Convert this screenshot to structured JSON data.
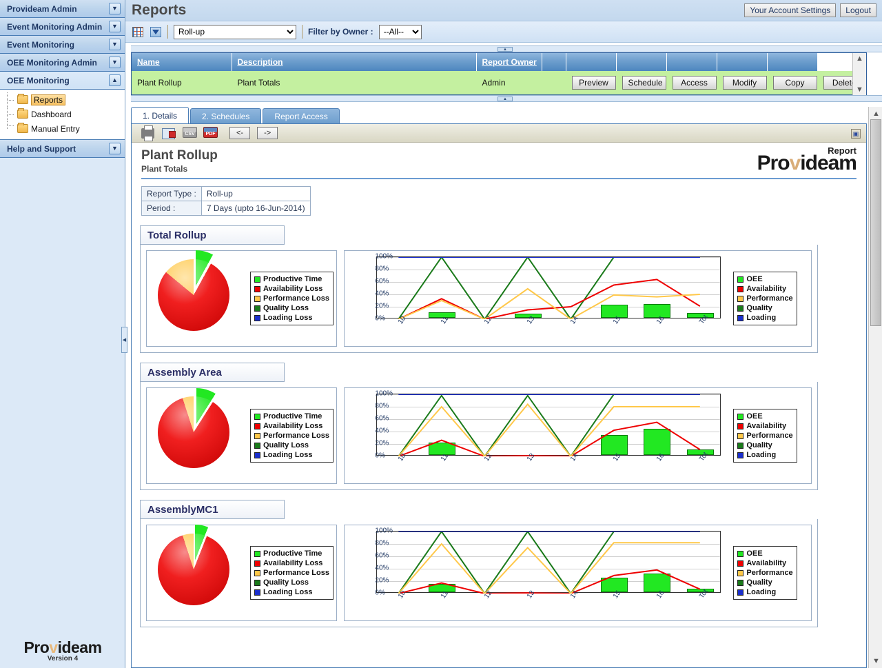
{
  "sidebar": {
    "groups": [
      {
        "label": "Provideam Admin",
        "icon": "chevron-down-icon",
        "expanded": false
      },
      {
        "label": "Event Monitoring Admin",
        "icon": "chevron-down-icon",
        "expanded": false
      },
      {
        "label": "Event Monitoring",
        "icon": "chevron-down-icon",
        "expanded": false
      },
      {
        "label": "OEE Monitoring Admin",
        "icon": "chevron-down-icon",
        "expanded": false
      },
      {
        "label": "OEE Monitoring",
        "icon": "chevron-up-icon",
        "expanded": true
      },
      {
        "label": "Help and Support",
        "icon": "chevron-down-icon",
        "expanded": false
      }
    ],
    "children": [
      {
        "label": "Reports",
        "selected": true
      },
      {
        "label": "Dashboard",
        "selected": false
      },
      {
        "label": "Manual Entry",
        "selected": false
      }
    ],
    "logo": {
      "pre": "Pro",
      "tick": "v",
      "post": "ideam",
      "version": "Version 4"
    }
  },
  "header": {
    "title": "Reports",
    "account_button": "Your Account Settings",
    "logout_button": "Logout"
  },
  "toolbar": {
    "grid_icon": "grid-icon",
    "filter_icon": "funnel-icon",
    "report_type_value": "Roll-up",
    "report_type_options": [
      "Roll-up"
    ],
    "filter_label": "Filter by Owner :",
    "filter_value": "--All--",
    "filter_options": [
      "--All--"
    ]
  },
  "report_list": {
    "columns": [
      "Name",
      "Description",
      "Report Owner",
      "",
      "",
      "",
      "",
      "",
      ""
    ],
    "row": {
      "name": "Plant Rollup",
      "description": "Plant Totals",
      "owner": "Admin",
      "actions": [
        "Preview",
        "Schedule",
        "Access",
        "Modify",
        "Copy",
        "Delete"
      ]
    }
  },
  "tabs": [
    {
      "label": "1. Details",
      "active": true
    },
    {
      "label": "2. Schedules",
      "active": false
    },
    {
      "label": "Report Access",
      "active": false
    }
  ],
  "report_toolbar": {
    "icons": [
      "print-icon",
      "email-icon",
      "csv-icon",
      "pdf-icon"
    ],
    "csv_label": "CSV",
    "pdf_label": "PDF",
    "prev_label": "<-",
    "next_label": "->"
  },
  "report": {
    "title": "Plant Rollup",
    "subtitle": "Plant Totals",
    "logo_tag": "Report",
    "logo": {
      "pre": "Pro",
      "tick": "v",
      "post": "ideam"
    },
    "close_icon": "close-icon",
    "info": [
      {
        "key": "Report Type :",
        "value": "Roll-up"
      },
      {
        "key": "Period :",
        "value": "7 Days (upto 16-Jun-2014)"
      }
    ]
  },
  "colors": {
    "productive": "#22e822",
    "availability": "#ee0000",
    "performance": "#ffc84a",
    "quality": "#1a7a1a",
    "loading": "#1a2ecc",
    "row_highlight": "#c4f0a0",
    "header_blue": "#4d86bf"
  },
  "pie_legend": [
    {
      "label": "Productive Time",
      "color": "#22e822"
    },
    {
      "label": "Availability Loss",
      "color": "#ee0000"
    },
    {
      "label": "Performance Loss",
      "color": "#ffc84a"
    },
    {
      "label": "Quality Loss",
      "color": "#1a7a1a"
    },
    {
      "label": "Loading Loss",
      "color": "#1a2ecc"
    }
  ],
  "line_legend": [
    {
      "label": "OEE",
      "color": "#22e822"
    },
    {
      "label": "Availability",
      "color": "#ee0000"
    },
    {
      "label": "Performance",
      "color": "#ffc84a"
    },
    {
      "label": "Quality",
      "color": "#1a7a1a"
    },
    {
      "label": "Loading",
      "color": "#1a2ecc"
    }
  ],
  "sections": [
    {
      "title": "Total Rollup"
    },
    {
      "title": "Assembly Area"
    },
    {
      "title": "AssemblyMC1"
    }
  ],
  "chart_data": [
    {
      "type": "pie",
      "title": "Total Rollup",
      "labels": [
        "Productive Time",
        "Availability Loss",
        "Performance Loss",
        "Quality Loss",
        "Loading Loss"
      ],
      "values": [
        8,
        78,
        14,
        0,
        0
      ],
      "colors": [
        "#22e822",
        "#ee0000",
        "#ffc84a",
        "#1a7a1a",
        "#1a2ecc"
      ],
      "exploded": [
        "Productive Time"
      ],
      "legend_position": "right"
    },
    {
      "type": "line",
      "title": "Total Rollup",
      "xlabel": "",
      "ylabel": "",
      "ylim": [
        0,
        100
      ],
      "yticks": [
        0,
        20,
        40,
        60,
        80,
        100
      ],
      "ytick_labels": [
        "0%",
        "20%",
        "40%",
        "60%",
        "80%",
        "100%"
      ],
      "categories": [
        "10",
        "11",
        "12",
        "13",
        "14",
        "15",
        "16",
        "Tot"
      ],
      "grid": true,
      "legend_position": "right",
      "bars": {
        "name": "OEE",
        "color": "#22e822",
        "values": [
          0,
          9,
          0,
          7,
          0,
          21,
          22,
          8
        ]
      },
      "series": [
        {
          "name": "Quality",
          "color": "#1a7a1a",
          "values": [
            0,
            100,
            0,
            100,
            0,
            100,
            100,
            100
          ]
        },
        {
          "name": "Availability",
          "color": "#ee0000",
          "values": [
            0,
            33,
            0,
            15,
            20,
            55,
            64,
            21
          ]
        },
        {
          "name": "Performance",
          "color": "#ffc84a",
          "values": [
            0,
            30,
            0,
            49,
            0,
            39,
            36,
            40
          ]
        },
        {
          "name": "Loading",
          "color": "#1a2ecc",
          "values": [
            100,
            100,
            100,
            100,
            100,
            100,
            100,
            100
          ]
        }
      ]
    },
    {
      "type": "pie",
      "title": "Assembly Area",
      "labels": [
        "Productive Time",
        "Availability Loss",
        "Performance Loss",
        "Quality Loss",
        "Loading Loss"
      ],
      "values": [
        9,
        86,
        5,
        0,
        0
      ],
      "colors": [
        "#22e822",
        "#ee0000",
        "#ffc84a",
        "#1a7a1a",
        "#1a2ecc"
      ],
      "exploded": [
        "Productive Time"
      ],
      "legend_position": "right"
    },
    {
      "type": "line",
      "title": "Assembly Area",
      "xlabel": "",
      "ylabel": "",
      "ylim": [
        0,
        100
      ],
      "yticks": [
        0,
        20,
        40,
        60,
        80,
        100
      ],
      "ytick_labels": [
        "0%",
        "20%",
        "40%",
        "60%",
        "80%",
        "100%"
      ],
      "categories": [
        "10",
        "11",
        "12",
        "13",
        "14",
        "15",
        "16",
        "Tot"
      ],
      "grid": true,
      "legend_position": "right",
      "bars": {
        "name": "OEE",
        "color": "#22e822",
        "values": [
          0,
          20,
          0,
          0,
          0,
          32,
          42,
          9
        ]
      },
      "series": [
        {
          "name": "Quality",
          "color": "#1a7a1a",
          "values": [
            0,
            98,
            0,
            98,
            0,
            100,
            100,
            100
          ]
        },
        {
          "name": "Availability",
          "color": "#ee0000",
          "values": [
            0,
            26,
            0,
            1,
            0,
            42,
            55,
            11
          ]
        },
        {
          "name": "Performance",
          "color": "#ffc84a",
          "values": [
            0,
            80,
            0,
            84,
            0,
            80,
            80,
            80
          ]
        },
        {
          "name": "Loading",
          "color": "#1a2ecc",
          "values": [
            100,
            100,
            100,
            100,
            100,
            100,
            100,
            100
          ]
        }
      ]
    },
    {
      "type": "pie",
      "title": "AssemblyMC1",
      "labels": [
        "Productive Time",
        "Availability Loss",
        "Performance Loss",
        "Quality Loss",
        "Loading Loss"
      ],
      "values": [
        6,
        89,
        5,
        0,
        0
      ],
      "colors": [
        "#22e822",
        "#ee0000",
        "#ffc84a",
        "#1a7a1a",
        "#1a2ecc"
      ],
      "exploded": [
        "Productive Time"
      ],
      "legend_position": "right"
    },
    {
      "type": "line",
      "title": "AssemblyMC1",
      "xlabel": "",
      "ylabel": "",
      "ylim": [
        0,
        100
      ],
      "yticks": [
        0,
        20,
        40,
        60,
        80,
        100
      ],
      "ytick_labels": [
        "0%",
        "20%",
        "40%",
        "60%",
        "80%",
        "100%"
      ],
      "categories": [
        "10",
        "11",
        "12",
        "13",
        "14",
        "15",
        "16",
        "Tot"
      ],
      "grid": true,
      "legend_position": "right",
      "bars": {
        "name": "OEE",
        "color": "#22e822",
        "values": [
          0,
          13,
          0,
          0,
          0,
          23,
          30,
          6
        ]
      },
      "series": [
        {
          "name": "Quality",
          "color": "#1a7a1a",
          "values": [
            0,
            100,
            0,
            100,
            0,
            100,
            100,
            100
          ]
        },
        {
          "name": "Availability",
          "color": "#ee0000",
          "values": [
            0,
            17,
            0,
            1,
            0,
            29,
            38,
            7
          ]
        },
        {
          "name": "Performance",
          "color": "#ffc84a",
          "values": [
            0,
            80,
            0,
            74,
            0,
            82,
            82,
            82
          ]
        },
        {
          "name": "Loading",
          "color": "#1a2ecc",
          "values": [
            100,
            100,
            100,
            100,
            100,
            100,
            100,
            100
          ]
        }
      ]
    }
  ]
}
